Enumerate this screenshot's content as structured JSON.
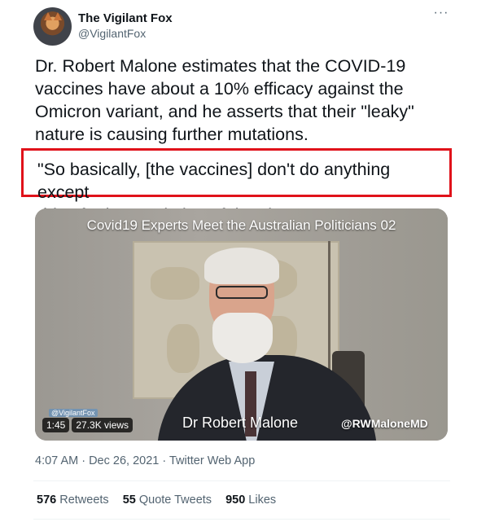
{
  "author": {
    "name": "The Vigilant Fox",
    "handle": "@VigilantFox"
  },
  "more_icon": "···",
  "tweet": {
    "text": "Dr. Robert Malone estimates that the COVID-19\nvaccines have about a 10% efficacy against the\nOmicron variant, and he asserts that their \"leaky\"\nnature is causing further mutations.",
    "quote": "\"So basically, [the vaccines] don't do anything except\ndrive further evolution of the virus.\""
  },
  "video": {
    "title": "Covid19 Experts Meet the Australian Politicians 02",
    "speaker": "Dr Robert Malone",
    "credit": "@RWMaloneMD",
    "watermark": "@VigilantFox",
    "duration": "1:45",
    "views": "27.3K views"
  },
  "meta": "4:07 AM · Dec 26, 2021 · Twitter Web App",
  "stats": {
    "retweets_count": "576",
    "retweets_label": "Retweets",
    "quotes_count": "55",
    "quotes_label": "Quote Tweets",
    "likes_count": "950",
    "likes_label": "Likes"
  },
  "colors": {
    "highlight_border": "#e0121a",
    "secondary_text": "#536471"
  }
}
